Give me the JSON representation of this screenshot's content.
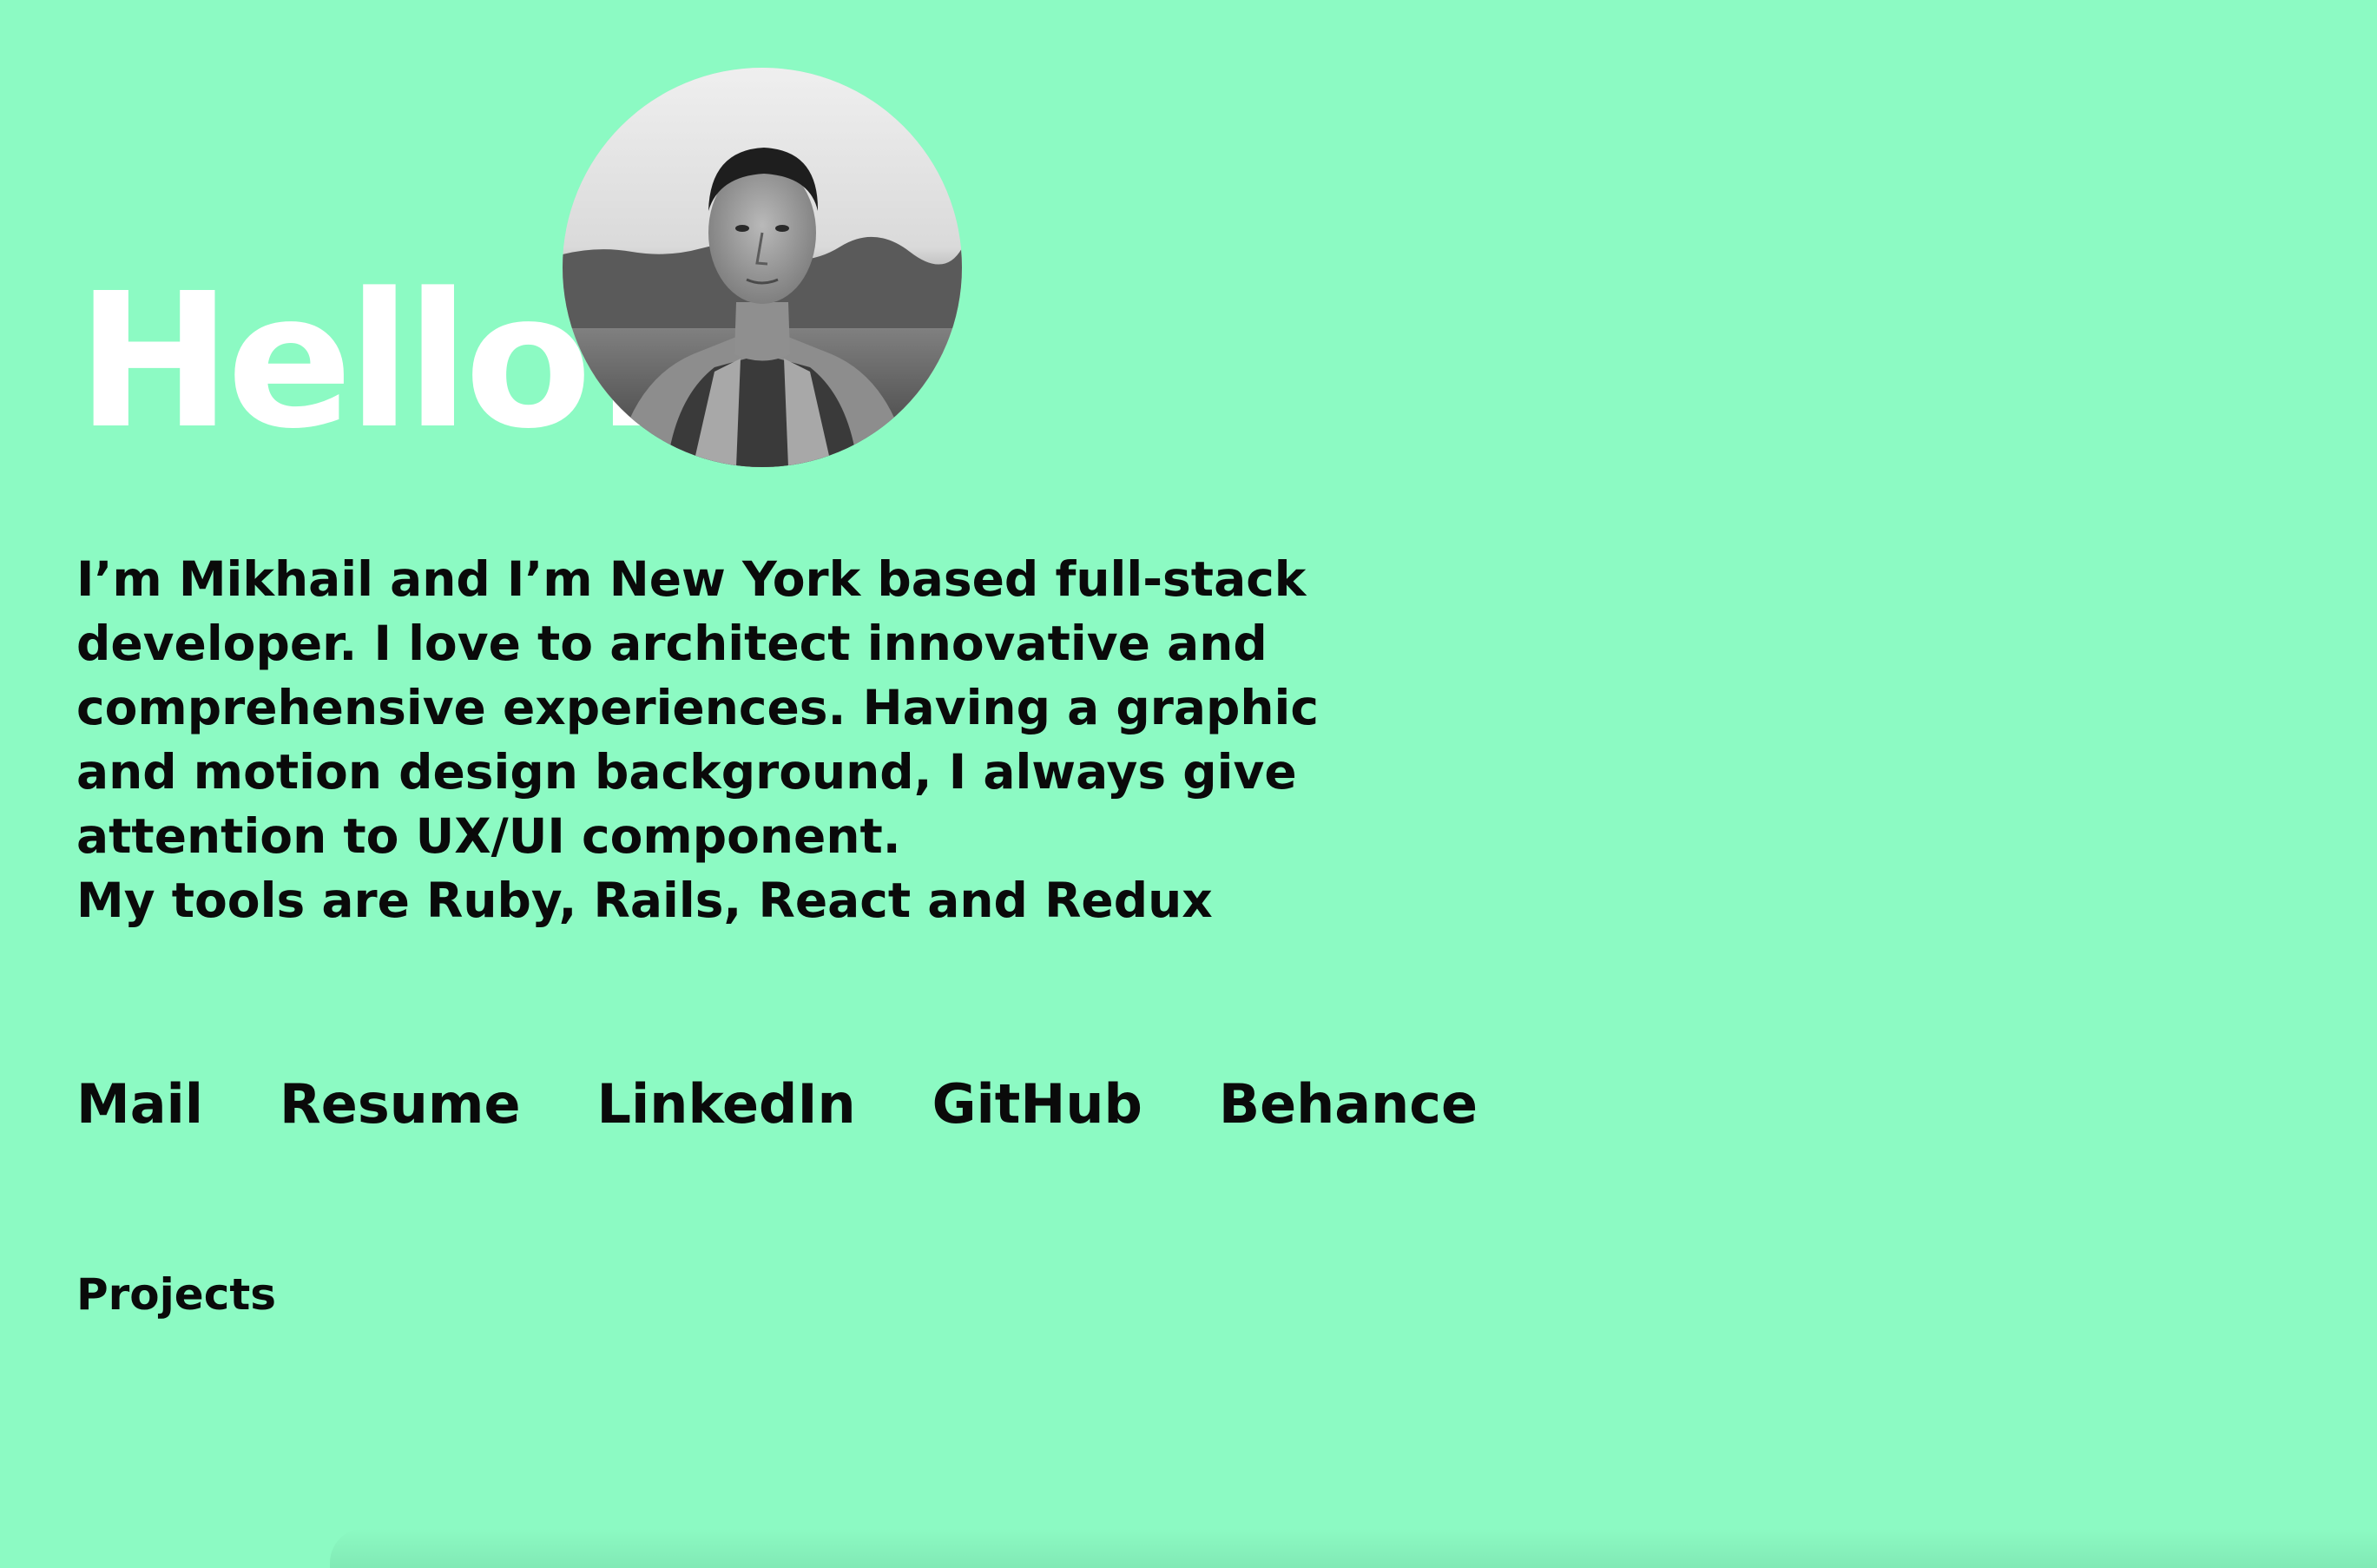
{
  "hero": {
    "greeting": "Hello!",
    "avatar_alt": "Portrait photo"
  },
  "intro": {
    "lines": [
      "I’m Mikhail and I’m New York based full-stack",
      "developer. I love to architect innovative and",
      "comprehensive experiences. Having a graphic",
      "and motion design background, I always give",
      "attention to UX/UI component.",
      "My tools are Ruby, Rails, React and Redux"
    ]
  },
  "links": {
    "mail": "Mail",
    "resume": "Resume",
    "linkedin": "LinkedIn",
    "github": "GitHub",
    "behance": "Behance"
  },
  "projects_label": "Projects",
  "colors": {
    "background": "#8cfac3",
    "heading": "#ffffff",
    "text": "#0a0a0a"
  }
}
